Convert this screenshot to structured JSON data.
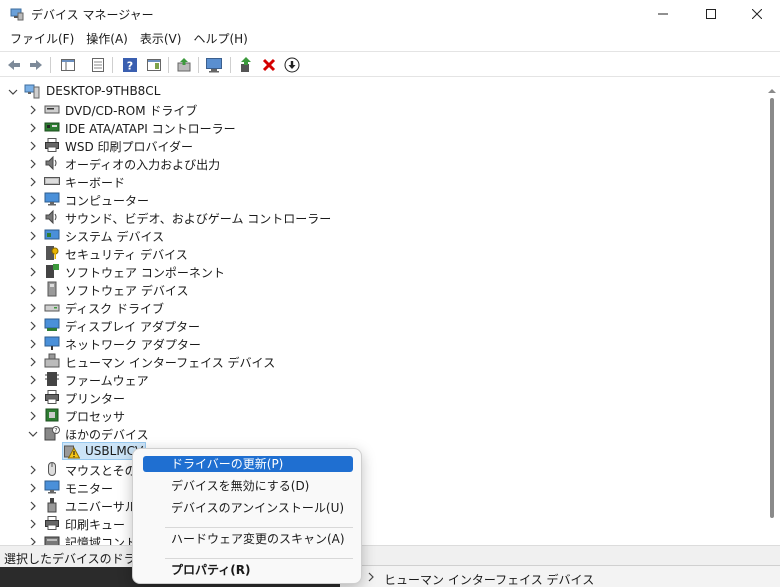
{
  "window": {
    "title": "デバイス マネージャー"
  },
  "menu": [
    {
      "label": "ファイル(F)"
    },
    {
      "label": "操作(A)"
    },
    {
      "label": "表示(V)"
    },
    {
      "label": "ヘルプ(H)"
    }
  ],
  "toolbar": [
    {
      "icon": "back-arrow-icon"
    },
    {
      "icon": "forward-arrow-icon"
    },
    {
      "icon": "show-hide-console-tree-icon"
    },
    {
      "icon": "properties-icon"
    },
    {
      "icon": "help-icon"
    },
    {
      "icon": "action-pane-icon"
    },
    {
      "icon": "update-driver-icon"
    },
    {
      "icon": "scan-hardware-icon"
    },
    {
      "icon": "enable-device-icon"
    },
    {
      "icon": "uninstall-device-icon"
    },
    {
      "icon": "disable-device-icon"
    }
  ],
  "tree": {
    "root": "DESKTOP-9THB8CL",
    "categories": [
      {
        "label": "DVD/CD-ROM ドライブ",
        "icon": "dvd-drive-icon"
      },
      {
        "label": "IDE ATA/ATAPI コントローラー",
        "icon": "ide-controller-icon"
      },
      {
        "label": "WSD 印刷プロバイダー",
        "icon": "printer-icon"
      },
      {
        "label": "オーディオの入力および出力",
        "icon": "speaker-icon"
      },
      {
        "label": "キーボード",
        "icon": "keyboard-icon"
      },
      {
        "label": "コンピューター",
        "icon": "monitor-icon"
      },
      {
        "label": "サウンド、ビデオ、およびゲーム コントローラー",
        "icon": "speaker-icon"
      },
      {
        "label": "システム デバイス",
        "icon": "system-device-icon"
      },
      {
        "label": "セキュリティ デバイス",
        "icon": "security-key-icon"
      },
      {
        "label": "ソフトウェア コンポーネント",
        "icon": "software-component-icon"
      },
      {
        "label": "ソフトウェア デバイス",
        "icon": "software-device-icon"
      },
      {
        "label": "ディスク ドライブ",
        "icon": "disk-drive-icon"
      },
      {
        "label": "ディスプレイ アダプター",
        "icon": "display-adapter-icon"
      },
      {
        "label": "ネットワーク アダプター",
        "icon": "network-adapter-icon"
      },
      {
        "label": "ヒューマン インターフェイス デバイス",
        "icon": "hid-icon"
      },
      {
        "label": "ファームウェア",
        "icon": "firmware-icon"
      },
      {
        "label": "プリンター",
        "icon": "printer-icon"
      },
      {
        "label": "プロセッサ",
        "icon": "processor-icon"
      },
      {
        "label": "ほかのデバイス",
        "icon": "unknown-device-icon",
        "expanded": true
      },
      {
        "label": "USBLMCV",
        "icon": "warning-device-icon",
        "child": true,
        "selected": true
      },
      {
        "label": "マウスとそのほ",
        "icon": "mouse-icon"
      },
      {
        "label": "モニター",
        "icon": "monitor-icon"
      },
      {
        "label": "ユニバーサル シ",
        "icon": "usb-icon"
      },
      {
        "label": "印刷キュー",
        "icon": "printer-icon"
      },
      {
        "label": "記憶域コントロ",
        "icon": "storage-controller-icon"
      }
    ]
  },
  "statusbar": {
    "text": "選択したデバイスのドライバー"
  },
  "background_window": {
    "text": "ヒューマン インターフェイス デバイス"
  },
  "context_menu": {
    "items": [
      {
        "label": "ドライバーの更新(P)",
        "highlighted": true
      },
      {
        "label": "デバイスを無効にする(D)"
      },
      {
        "label": "デバイスのアンインストール(U)"
      },
      {
        "separator": true
      },
      {
        "label": "ハードウェア変更のスキャン(A)"
      },
      {
        "separator": true
      },
      {
        "label": "プロパティ(R)",
        "bold": true
      }
    ]
  },
  "colors": {
    "accent": "#1f6fd1",
    "selection": "#cce4f7",
    "close_red": "#d40000"
  }
}
